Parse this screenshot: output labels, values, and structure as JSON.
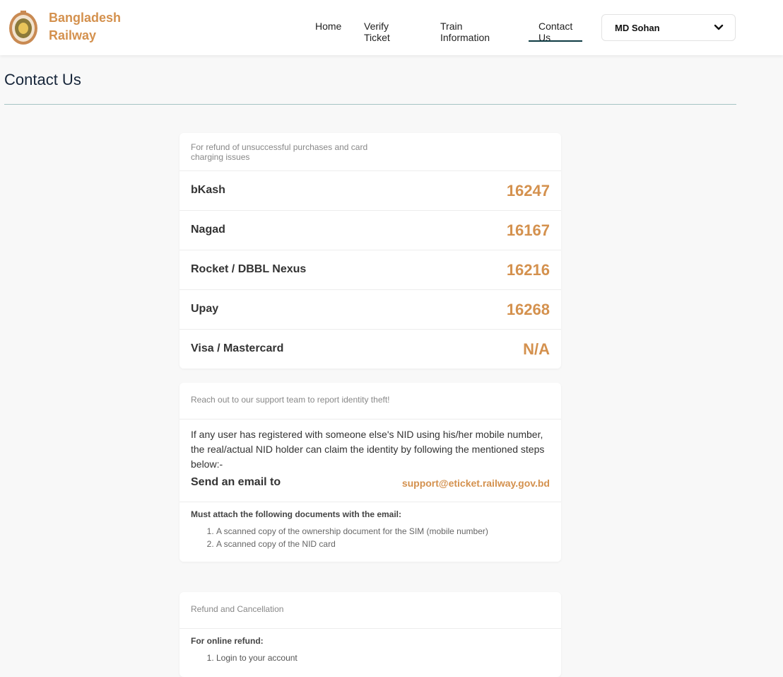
{
  "header": {
    "brand_line1": "Bangladesh",
    "brand_line2": "Railway",
    "nav": [
      {
        "label": "Home"
      },
      {
        "label": "Verify Ticket"
      },
      {
        "label": "Train Information"
      },
      {
        "label": "Contact Us"
      }
    ],
    "active_nav": "Contact Us",
    "user_name": "MD Sohan"
  },
  "page": {
    "title": "Contact Us"
  },
  "refund_card": {
    "heading": "For refund of unsuccessful purchases and card charging issues",
    "rows": [
      {
        "label": "bKash",
        "number": "16247"
      },
      {
        "label": "Nagad",
        "number": "16167"
      },
      {
        "label": "Rocket / DBBL Nexus",
        "number": "16216"
      },
      {
        "label": "Upay",
        "number": "16268"
      },
      {
        "label": "Visa / Mastercard",
        "number": "N/A"
      }
    ]
  },
  "identity_card": {
    "heading": "Reach out to our support team to report identity theft!",
    "paragraph": "If any user has registered with someone else's NID using his/her mobile number, the real/actual NID holder can claim the identity by following the mentioned steps below:-",
    "email_label": "Send an email to",
    "email": "support@eticket.railway.gov.bd",
    "docs_title": "Must attach the following documents with the email:",
    "docs": [
      "A scanned copy of the ownership document for the SIM (mobile number)",
      "A scanned copy of the NID card"
    ]
  },
  "cancellation_card": {
    "heading": "Refund and Cancellation",
    "online_title": "For online refund:",
    "steps": [
      "Login to your account"
    ]
  },
  "colors": {
    "accent": "#d4914e",
    "title": "#17263a",
    "rule": "#a6c4c4"
  }
}
